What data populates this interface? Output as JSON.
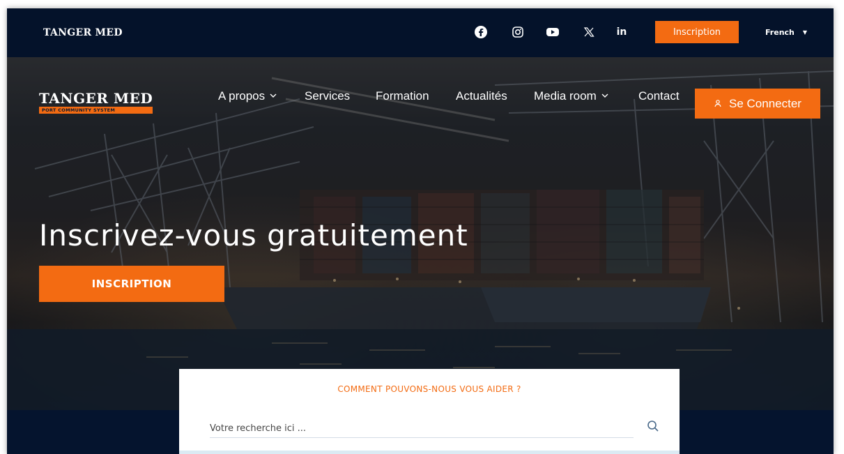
{
  "topbar": {
    "brand": "TANGER MED",
    "social": [
      {
        "name": "facebook-icon"
      },
      {
        "name": "instagram-icon"
      },
      {
        "name": "youtube-icon"
      },
      {
        "name": "x-icon"
      },
      {
        "name": "linkedin-icon"
      }
    ],
    "inscription_label": "Inscription",
    "language": "French"
  },
  "header": {
    "logo_line1": "TANGER MED",
    "logo_line2": "PORT COMMUNITY SYSTEM",
    "nav": [
      {
        "label": "A propos",
        "dropdown": true
      },
      {
        "label": "Services",
        "dropdown": false
      },
      {
        "label": "Formation",
        "dropdown": false
      },
      {
        "label": "Actualités",
        "dropdown": false
      },
      {
        "label": "Media room",
        "dropdown": true
      },
      {
        "label": "Contact",
        "dropdown": false
      }
    ],
    "connect_label": "Se Connecter"
  },
  "hero": {
    "title": "Inscrivez-vous gratuitement",
    "button_label": "INSCRIPTION"
  },
  "search": {
    "heading": "COMMENT POUVONS-NOUS VOUS AIDER ?",
    "placeholder": "Votre recherche ici ..."
  },
  "colors": {
    "accent": "#f36b12",
    "navy": "#04122a"
  }
}
